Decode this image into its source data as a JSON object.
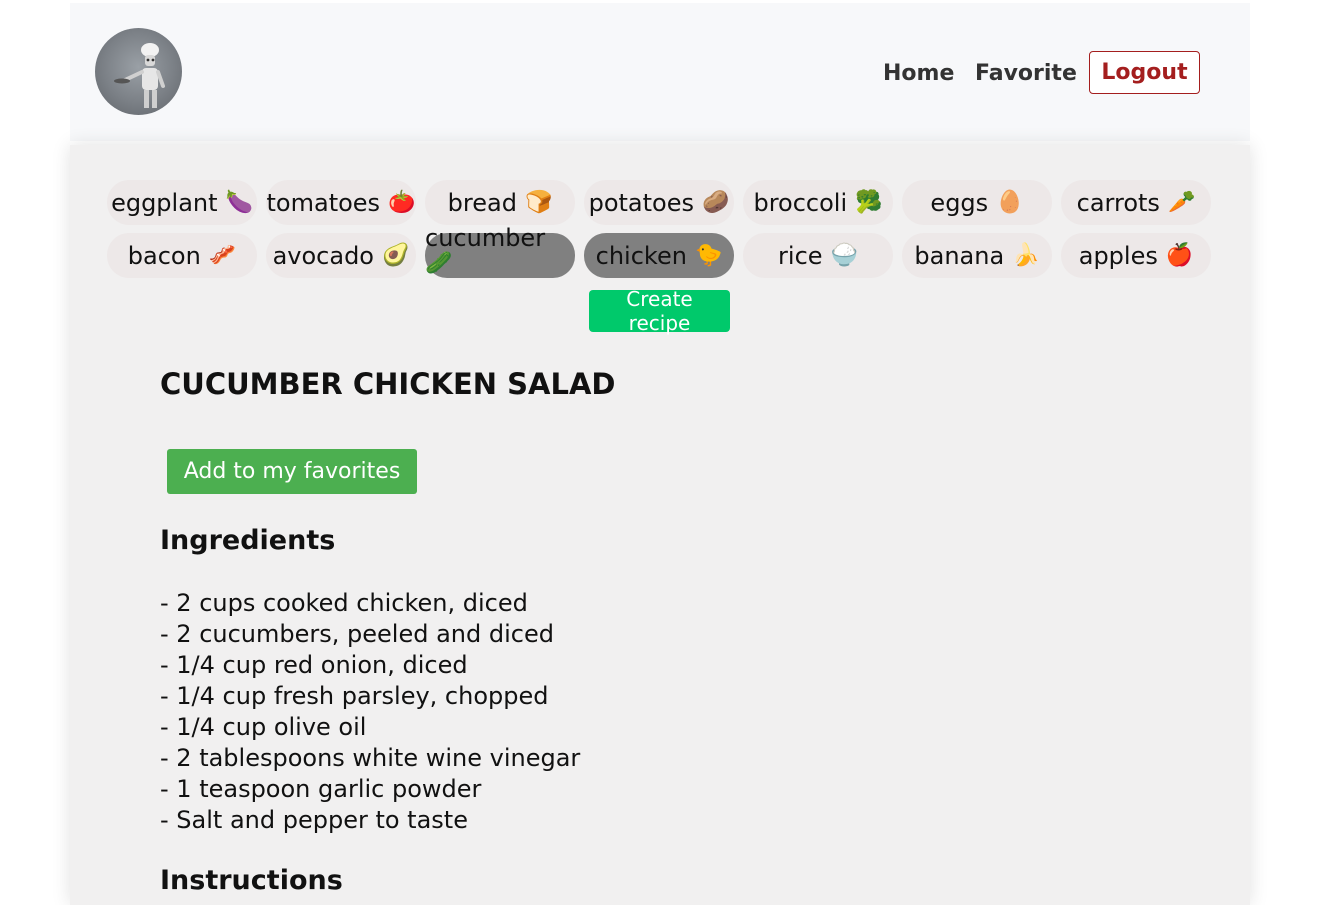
{
  "header": {
    "nav": {
      "home": "Home",
      "favorite": "Favorite",
      "logout": "Logout"
    }
  },
  "ingredients_picker": {
    "row1": [
      {
        "label": "eggplant",
        "emoji": "🍆",
        "selected": false
      },
      {
        "label": "tomatoes",
        "emoji": "🍅",
        "selected": false
      },
      {
        "label": "bread",
        "emoji": "🍞",
        "selected": false
      },
      {
        "label": "potatoes",
        "emoji": "🥔",
        "selected": false
      },
      {
        "label": "broccoli",
        "emoji": "🥦",
        "selected": false
      },
      {
        "label": "eggs",
        "emoji": "🥚",
        "selected": false
      },
      {
        "label": "carrots",
        "emoji": "🥕",
        "selected": false
      }
    ],
    "row2": [
      {
        "label": "bacon",
        "emoji": "🥓",
        "selected": false
      },
      {
        "label": "avocado",
        "emoji": "🥑",
        "selected": false
      },
      {
        "label": "cucumber",
        "emoji": "🥒",
        "selected": true
      },
      {
        "label": "chicken",
        "emoji": "🐤",
        "selected": true
      },
      {
        "label": "rice",
        "emoji": "🍚",
        "selected": false
      },
      {
        "label": "banana",
        "emoji": "🍌",
        "selected": false
      },
      {
        "label": "apples",
        "emoji": "🍎",
        "selected": false
      }
    ],
    "create_label": "Create recipe"
  },
  "recipe": {
    "title": "CUCUMBER CHICKEN SALAD",
    "favorite_label": "Add to my favorites",
    "ingredients_heading": "Ingredients",
    "ingredients": [
      "- 2 cups cooked chicken, diced",
      "- 2 cucumbers, peeled and diced",
      "- 1/4 cup red onion, diced",
      "- 1/4 cup fresh parsley, chopped",
      "- 1/4 cup olive oil",
      "- 2 tablespoons white wine vinegar",
      "- 1 teaspoon garlic powder",
      "- Salt and pepper to taste"
    ],
    "instructions_heading": "Instructions"
  },
  "colors": {
    "logout": "#a41e1e",
    "create_button": "#00c96b",
    "favorite_button": "#4caf50",
    "chip": "#ede8e8",
    "chip_selected": "#808080"
  }
}
